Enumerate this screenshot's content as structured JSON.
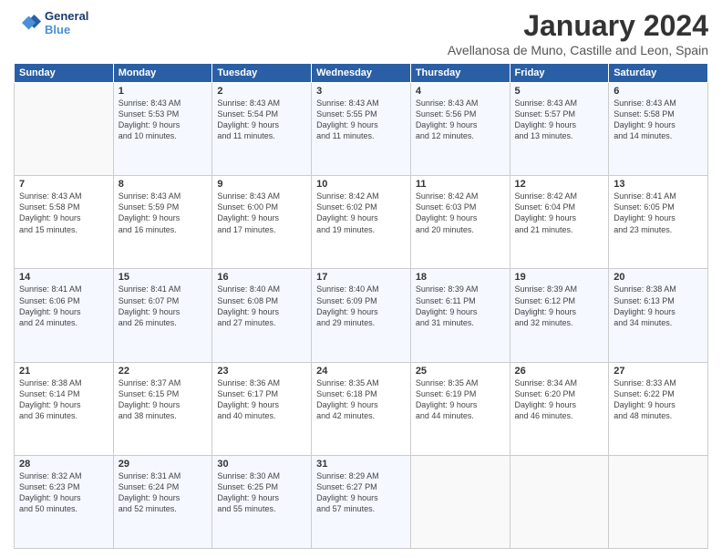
{
  "logo": {
    "line1": "General",
    "line2": "Blue"
  },
  "title": "January 2024",
  "subtitle": "Avellanosa de Muno, Castille and Leon, Spain",
  "headers": [
    "Sunday",
    "Monday",
    "Tuesday",
    "Wednesday",
    "Thursday",
    "Friday",
    "Saturday"
  ],
  "weeks": [
    [
      {
        "day": "",
        "info": ""
      },
      {
        "day": "1",
        "info": "Sunrise: 8:43 AM\nSunset: 5:53 PM\nDaylight: 9 hours\nand 10 minutes."
      },
      {
        "day": "2",
        "info": "Sunrise: 8:43 AM\nSunset: 5:54 PM\nDaylight: 9 hours\nand 11 minutes."
      },
      {
        "day": "3",
        "info": "Sunrise: 8:43 AM\nSunset: 5:55 PM\nDaylight: 9 hours\nand 11 minutes."
      },
      {
        "day": "4",
        "info": "Sunrise: 8:43 AM\nSunset: 5:56 PM\nDaylight: 9 hours\nand 12 minutes."
      },
      {
        "day": "5",
        "info": "Sunrise: 8:43 AM\nSunset: 5:57 PM\nDaylight: 9 hours\nand 13 minutes."
      },
      {
        "day": "6",
        "info": "Sunrise: 8:43 AM\nSunset: 5:58 PM\nDaylight: 9 hours\nand 14 minutes."
      }
    ],
    [
      {
        "day": "7",
        "info": "Sunrise: 8:43 AM\nSunset: 5:58 PM\nDaylight: 9 hours\nand 15 minutes."
      },
      {
        "day": "8",
        "info": "Sunrise: 8:43 AM\nSunset: 5:59 PM\nDaylight: 9 hours\nand 16 minutes."
      },
      {
        "day": "9",
        "info": "Sunrise: 8:43 AM\nSunset: 6:00 PM\nDaylight: 9 hours\nand 17 minutes."
      },
      {
        "day": "10",
        "info": "Sunrise: 8:42 AM\nSunset: 6:02 PM\nDaylight: 9 hours\nand 19 minutes."
      },
      {
        "day": "11",
        "info": "Sunrise: 8:42 AM\nSunset: 6:03 PM\nDaylight: 9 hours\nand 20 minutes."
      },
      {
        "day": "12",
        "info": "Sunrise: 8:42 AM\nSunset: 6:04 PM\nDaylight: 9 hours\nand 21 minutes."
      },
      {
        "day": "13",
        "info": "Sunrise: 8:41 AM\nSunset: 6:05 PM\nDaylight: 9 hours\nand 23 minutes."
      }
    ],
    [
      {
        "day": "14",
        "info": "Sunrise: 8:41 AM\nSunset: 6:06 PM\nDaylight: 9 hours\nand 24 minutes."
      },
      {
        "day": "15",
        "info": "Sunrise: 8:41 AM\nSunset: 6:07 PM\nDaylight: 9 hours\nand 26 minutes."
      },
      {
        "day": "16",
        "info": "Sunrise: 8:40 AM\nSunset: 6:08 PM\nDaylight: 9 hours\nand 27 minutes."
      },
      {
        "day": "17",
        "info": "Sunrise: 8:40 AM\nSunset: 6:09 PM\nDaylight: 9 hours\nand 29 minutes."
      },
      {
        "day": "18",
        "info": "Sunrise: 8:39 AM\nSunset: 6:11 PM\nDaylight: 9 hours\nand 31 minutes."
      },
      {
        "day": "19",
        "info": "Sunrise: 8:39 AM\nSunset: 6:12 PM\nDaylight: 9 hours\nand 32 minutes."
      },
      {
        "day": "20",
        "info": "Sunrise: 8:38 AM\nSunset: 6:13 PM\nDaylight: 9 hours\nand 34 minutes."
      }
    ],
    [
      {
        "day": "21",
        "info": "Sunrise: 8:38 AM\nSunset: 6:14 PM\nDaylight: 9 hours\nand 36 minutes."
      },
      {
        "day": "22",
        "info": "Sunrise: 8:37 AM\nSunset: 6:15 PM\nDaylight: 9 hours\nand 38 minutes."
      },
      {
        "day": "23",
        "info": "Sunrise: 8:36 AM\nSunset: 6:17 PM\nDaylight: 9 hours\nand 40 minutes."
      },
      {
        "day": "24",
        "info": "Sunrise: 8:35 AM\nSunset: 6:18 PM\nDaylight: 9 hours\nand 42 minutes."
      },
      {
        "day": "25",
        "info": "Sunrise: 8:35 AM\nSunset: 6:19 PM\nDaylight: 9 hours\nand 44 minutes."
      },
      {
        "day": "26",
        "info": "Sunrise: 8:34 AM\nSunset: 6:20 PM\nDaylight: 9 hours\nand 46 minutes."
      },
      {
        "day": "27",
        "info": "Sunrise: 8:33 AM\nSunset: 6:22 PM\nDaylight: 9 hours\nand 48 minutes."
      }
    ],
    [
      {
        "day": "28",
        "info": "Sunrise: 8:32 AM\nSunset: 6:23 PM\nDaylight: 9 hours\nand 50 minutes."
      },
      {
        "day": "29",
        "info": "Sunrise: 8:31 AM\nSunset: 6:24 PM\nDaylight: 9 hours\nand 52 minutes."
      },
      {
        "day": "30",
        "info": "Sunrise: 8:30 AM\nSunset: 6:25 PM\nDaylight: 9 hours\nand 55 minutes."
      },
      {
        "day": "31",
        "info": "Sunrise: 8:29 AM\nSunset: 6:27 PM\nDaylight: 9 hours\nand 57 minutes."
      },
      {
        "day": "",
        "info": ""
      },
      {
        "day": "",
        "info": ""
      },
      {
        "day": "",
        "info": ""
      }
    ]
  ]
}
